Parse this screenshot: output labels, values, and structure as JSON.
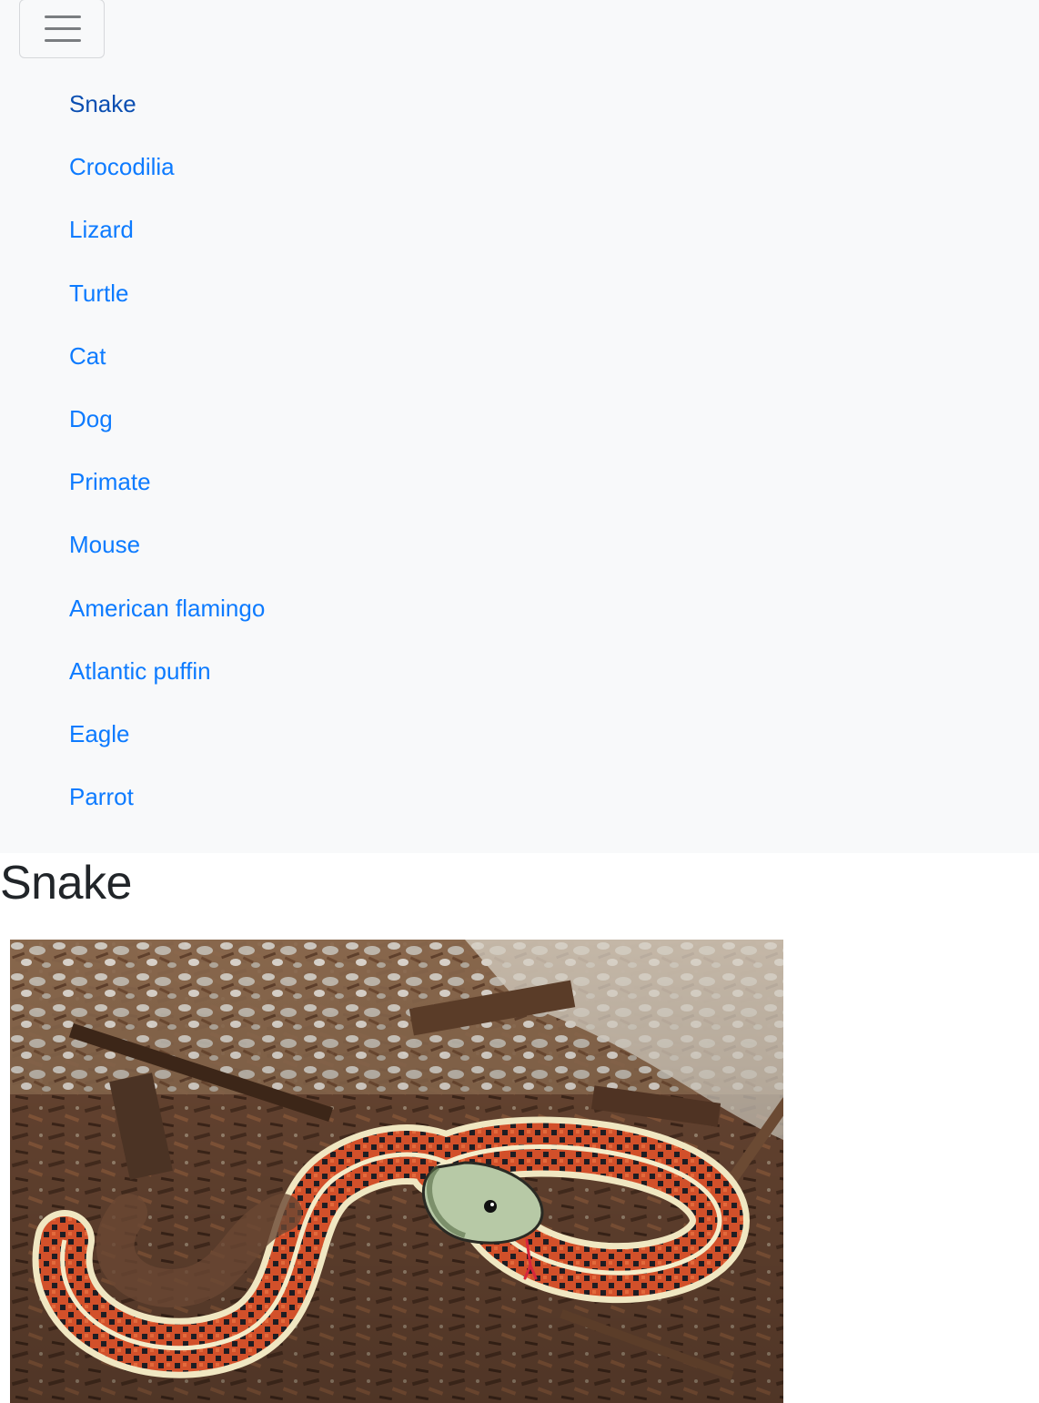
{
  "navbar": {
    "toggler_icon": "hamburger-menu-icon",
    "items": [
      {
        "label": "Snake",
        "active": true
      },
      {
        "label": "Crocodilia",
        "active": false
      },
      {
        "label": "Lizard",
        "active": false
      },
      {
        "label": "Turtle",
        "active": false
      },
      {
        "label": "Cat",
        "active": false
      },
      {
        "label": "Dog",
        "active": false
      },
      {
        "label": "Primate",
        "active": false
      },
      {
        "label": "Mouse",
        "active": false
      },
      {
        "label": "American flamingo",
        "active": false
      },
      {
        "label": "Atlantic puffin",
        "active": false
      },
      {
        "label": "Eagle",
        "active": false
      },
      {
        "label": "Parrot",
        "active": false
      }
    ]
  },
  "main": {
    "title": "Snake"
  },
  "colors": {
    "navbar_bg": "#f8f9fa",
    "link": "#0d7bff",
    "link_active": "#0b4fb2",
    "heading": "#212529"
  }
}
